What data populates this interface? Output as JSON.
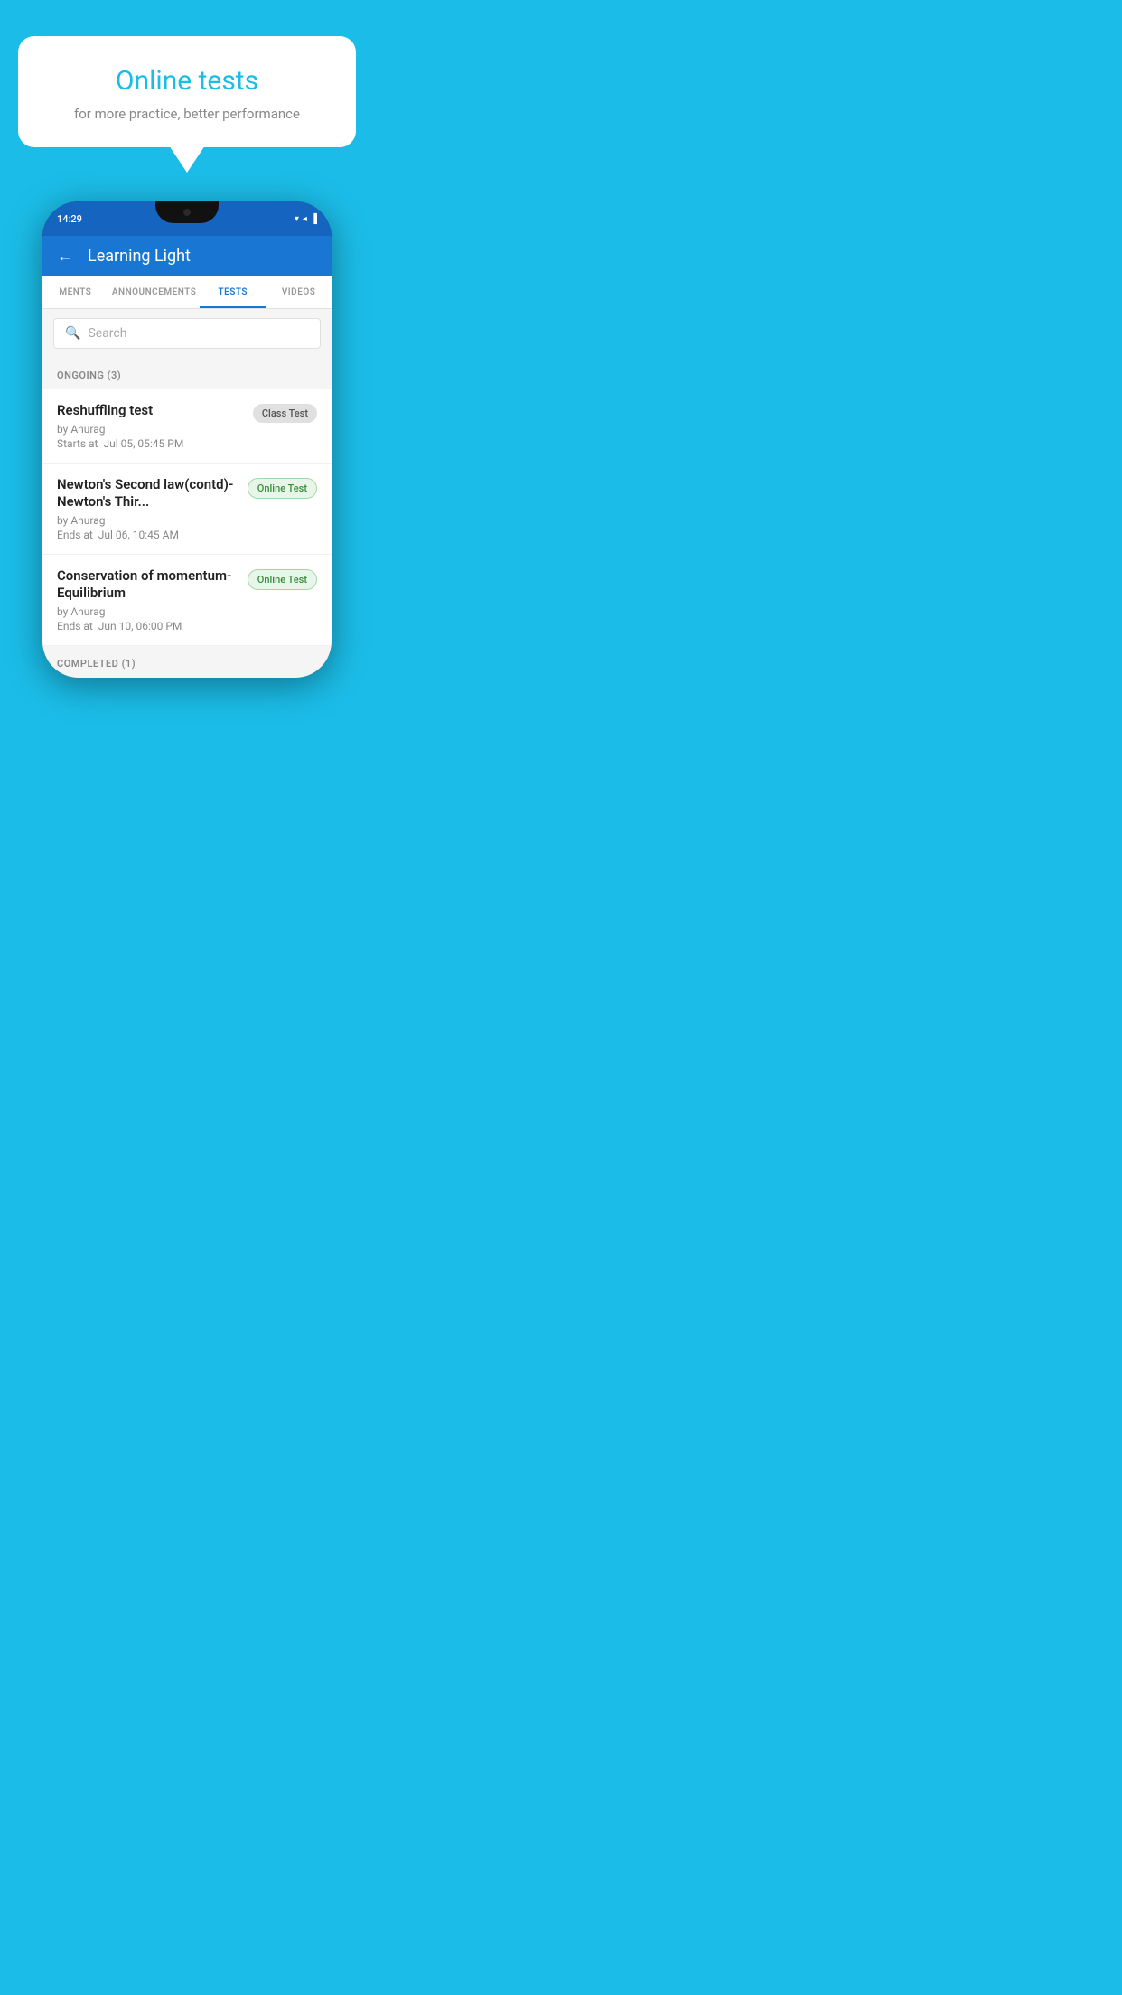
{
  "background_color": "#1bbde8",
  "bubble": {
    "title": "Online tests",
    "subtitle": "for more practice, better performance"
  },
  "phone": {
    "status_time": "14:29",
    "status_icons": [
      "▼",
      "◀",
      "▐"
    ],
    "header": {
      "back_label": "←",
      "title": "Learning Light"
    },
    "tabs": [
      {
        "label": "MENTS",
        "active": false
      },
      {
        "label": "ANNOUNCEMENTS",
        "active": false
      },
      {
        "label": "TESTS",
        "active": true
      },
      {
        "label": "VIDEOS",
        "active": false
      }
    ],
    "search": {
      "placeholder": "Search"
    },
    "section_ongoing": {
      "label": "ONGOING (3)"
    },
    "tests": [
      {
        "name": "Reshuffling test",
        "author": "by Anurag",
        "time_label": "Starts at",
        "time": "Jul 05, 05:45 PM",
        "badge": "Class Test",
        "badge_type": "class"
      },
      {
        "name": "Newton's Second law(contd)-Newton's Thir...",
        "author": "by Anurag",
        "time_label": "Ends at",
        "time": "Jul 06, 10:45 AM",
        "badge": "Online Test",
        "badge_type": "online"
      },
      {
        "name": "Conservation of momentum-Equilibrium",
        "author": "by Anurag",
        "time_label": "Ends at",
        "time": "Jun 10, 06:00 PM",
        "badge": "Online Test",
        "badge_type": "online"
      }
    ],
    "section_completed": {
      "label": "COMPLETED (1)"
    }
  }
}
